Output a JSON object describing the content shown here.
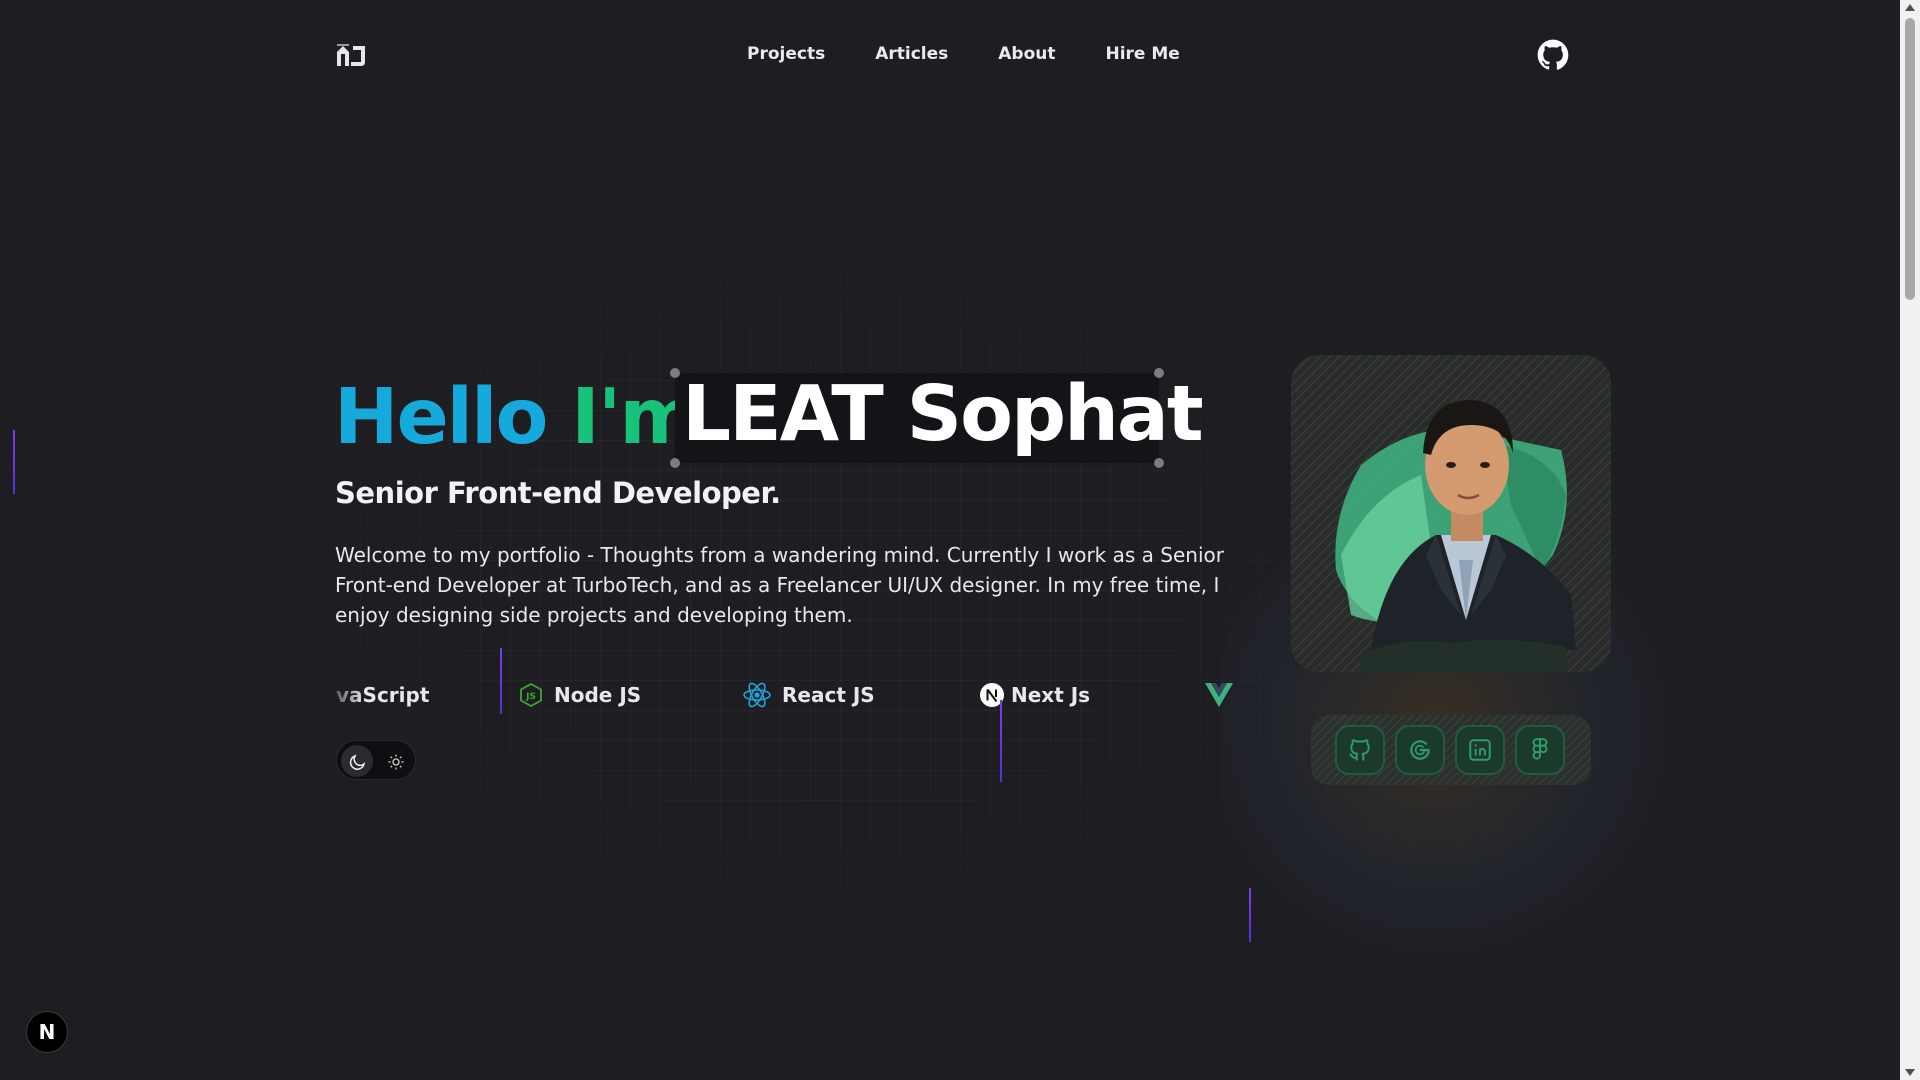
{
  "nav": {
    "items": [
      {
        "label": "Projects"
      },
      {
        "label": "Articles"
      },
      {
        "label": "About"
      },
      {
        "label": "Hire Me"
      }
    ]
  },
  "hero": {
    "greeting": "Hello",
    "im": "I'm",
    "name": "LEAT Sophat",
    "subtitle": "Senior Front-end Developer.",
    "description": "Welcome to my portfolio - Thoughts from a wandering mind. Currently I work as a Senior Front-end Developer at TurboTech, and as a Freelancer UI/UX designer. In my free time, I enjoy designing side projects and developing them."
  },
  "tech": [
    {
      "label": "vaScript"
    },
    {
      "label": "Node JS",
      "icon": "nodejs-icon"
    },
    {
      "label": "React JS",
      "icon": "react-icon"
    },
    {
      "label": "Next Js",
      "icon": "nextjs-icon"
    },
    {
      "label": "",
      "icon": "vue-icon"
    }
  ],
  "social": [
    {
      "icon": "github-icon"
    },
    {
      "icon": "google-icon"
    },
    {
      "icon": "linkedin-icon"
    },
    {
      "icon": "figma-icon"
    }
  ],
  "badge": {
    "label": "N"
  },
  "colors": {
    "background": "#1e1d22",
    "hello": "#16a9dc",
    "im": "#18c27a",
    "accent_green": "#18c27a",
    "social_icon": "#2f9c6a",
    "divider_purple": "#7b3cf5"
  }
}
